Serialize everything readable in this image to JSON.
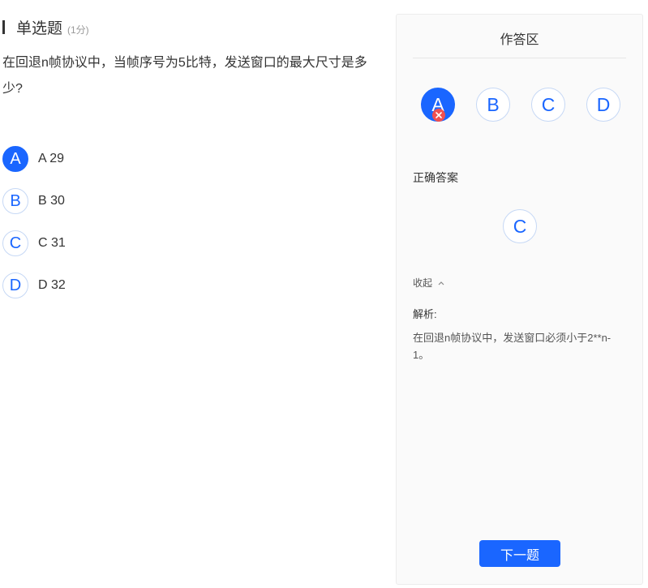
{
  "question": {
    "type_label": "单选题",
    "score_label": "(1分)",
    "text": "在回退n帧协议中，当帧序号为5比特，发送窗口的最大尺寸是多少?",
    "options": [
      {
        "letter": "A",
        "text": "A 29",
        "selected": true
      },
      {
        "letter": "B",
        "text": "B 30",
        "selected": false
      },
      {
        "letter": "C",
        "text": "C 31",
        "selected": false
      },
      {
        "letter": "D",
        "text": "D 32",
        "selected": false
      }
    ]
  },
  "answer_panel": {
    "title": "作答区",
    "choices": [
      "A",
      "B",
      "C",
      "D"
    ],
    "selected_choice": "A",
    "selected_status": "wrong",
    "correct_label": "正确答案",
    "correct_answer": "C",
    "collapse_label": "收起",
    "analysis_label": "解析:",
    "analysis_text": "在回退n帧协议中，发送窗口必须小于2**n-1。",
    "next_button": "下一题"
  },
  "colors": {
    "accent": "#1a66ff",
    "wrong": "#f05050",
    "panel_bg": "#fafafa"
  },
  "icons": {
    "wrong_badge": "close-icon",
    "collapse": "chevron-up-icon"
  }
}
